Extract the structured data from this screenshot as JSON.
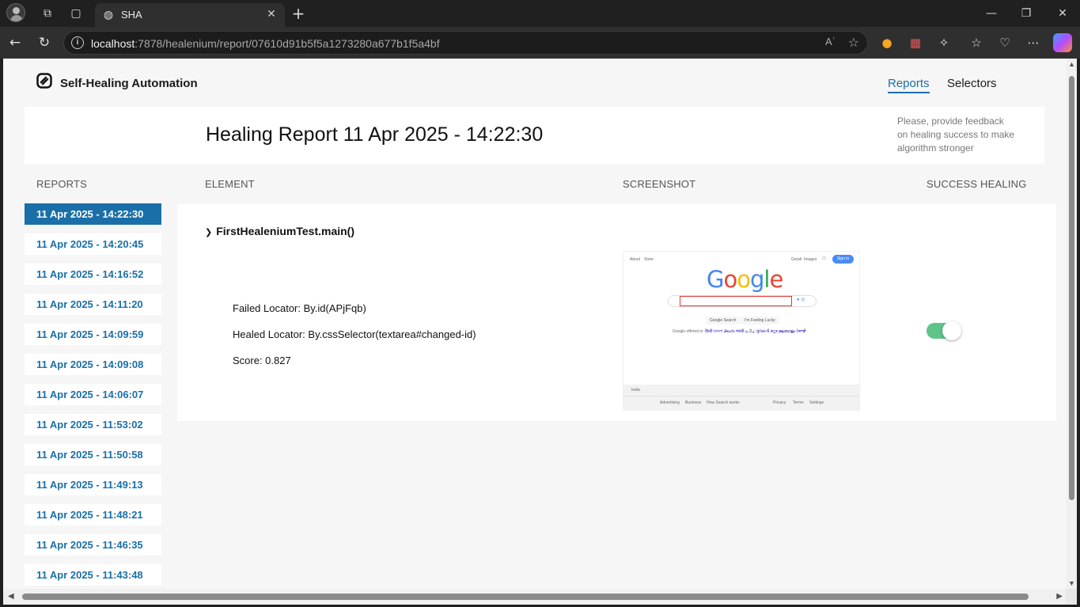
{
  "browser": {
    "tab_title": "SHA",
    "url_host": "localhost",
    "url_rest": ":7878/healenium/report/07610d91b5f5a1273280a677b1f5a4bf",
    "read_aloud": "Aʾ"
  },
  "header": {
    "brand": "Self-Healing Automation",
    "nav_reports": "Reports",
    "nav_selectors": "Selectors"
  },
  "report": {
    "title": "Healing Report 11 Apr 2025 - 14:22:30",
    "feedback": "Please, provide feedback on healing success to make algorithm stronger"
  },
  "columns": {
    "reports": "REPORTS",
    "element": "ELEMENT",
    "screenshot": "SCREENSHOT",
    "success": "SUCCESS HEALING"
  },
  "reports": [
    "11 Apr 2025 - 14:22:30",
    "11 Apr 2025 - 14:20:45",
    "11 Apr 2025 - 14:16:52",
    "11 Apr 2025 - 14:11:20",
    "11 Apr 2025 - 14:09:59",
    "11 Apr 2025 - 14:09:08",
    "11 Apr 2025 - 14:06:07",
    "11 Apr 2025 - 11:53:02",
    "11 Apr 2025 - 11:50:58",
    "11 Apr 2025 - 11:49:13",
    "11 Apr 2025 - 11:48:21",
    "11 Apr 2025 - 11:46:35",
    "11 Apr 2025 - 11:43:48"
  ],
  "entry": {
    "method": "FirstHealeniumTest.main()",
    "failed_locator": "Failed Locator: By.id(APjFqb)",
    "healed_locator": "Healed Locator: By.cssSelector(textarea#changed-id)",
    "score": "Score: 0.827",
    "healing_success": true
  },
  "screenshot": {
    "about": "About",
    "store": "Store",
    "gmail": "Gmail",
    "images": "Images",
    "signin": "Sign in",
    "btn_search": "Google Search",
    "btn_lucky": "I'm Feeling Lucky",
    "offered_prefix": "Google offered in:",
    "offered_langs": "हिन्दी বাংলা తెలుగు मराठी தமிழ் ગુજરાતી ಕನ್ನಡ മലയാളം ਪੰਜਾਬੀ",
    "country": "India",
    "f_advertising": "Advertising",
    "f_business": "Business",
    "f_how": "How Search works",
    "f_privacy": "Privacy",
    "f_terms": "Terms",
    "f_settings": "Settings"
  },
  "colors": {
    "accent": "#1a6fa8",
    "toggle_on": "#5ec48a"
  }
}
